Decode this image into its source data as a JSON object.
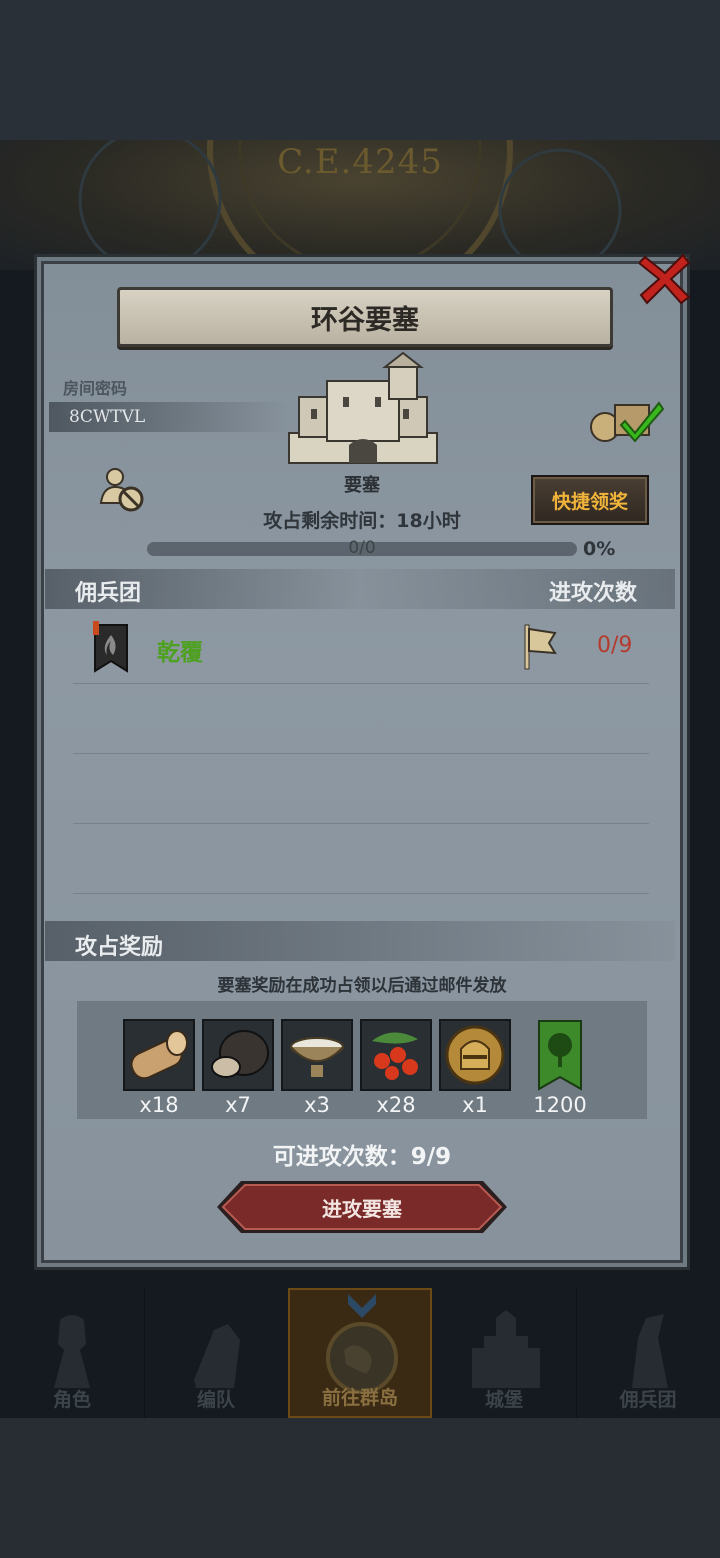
{
  "background": {
    "era_label": "C.E.4245"
  },
  "panel": {
    "title": "环谷要塞",
    "room_code_label": "房间密码",
    "room_code": "8CWTVL",
    "fortress_label": "要塞",
    "time_left": "攻占剩余时间：18小时",
    "progress_text": "0/0",
    "progress_percent": "0%",
    "progress_value": 0,
    "quick_claim_label": "快捷领奖",
    "mercenary_title": "佣兵团",
    "attack_count_title": "进攻次数",
    "guild": {
      "name": "乾覆",
      "attacks": "0/9"
    },
    "reward_title": "攻占奖励",
    "reward_note": "要塞奖励在成功占领以后通过邮件发放",
    "rewards": [
      {
        "icon": "wood-log-icon",
        "count": "x18"
      },
      {
        "icon": "truffle-icon",
        "count": "x7"
      },
      {
        "icon": "milk-bowl-icon",
        "count": "x3"
      },
      {
        "icon": "berries-icon",
        "count": "x28"
      },
      {
        "icon": "knight-helmet-icon",
        "count": "x1"
      },
      {
        "icon": "guild-tree-banner-icon",
        "count": "1200"
      }
    ],
    "attempts_text": "可进攻次数：9/9",
    "attack_button_label": "进攻要塞"
  },
  "nav": {
    "items": [
      {
        "label": "角色",
        "icon": "knight-icon"
      },
      {
        "label": "编队",
        "icon": "formation-icon"
      },
      {
        "label": "前往群岛",
        "icon": "globe-icon",
        "active": true
      },
      {
        "label": "城堡",
        "icon": "castle-icon"
      },
      {
        "label": "佣兵团",
        "icon": "mercenary-icon"
      }
    ]
  },
  "colors": {
    "guild_name": "#4ea020",
    "attack_ratio": "#b43a2e",
    "quick_claim_text": "#f0b43a",
    "attack_button": "#7a2a28"
  }
}
